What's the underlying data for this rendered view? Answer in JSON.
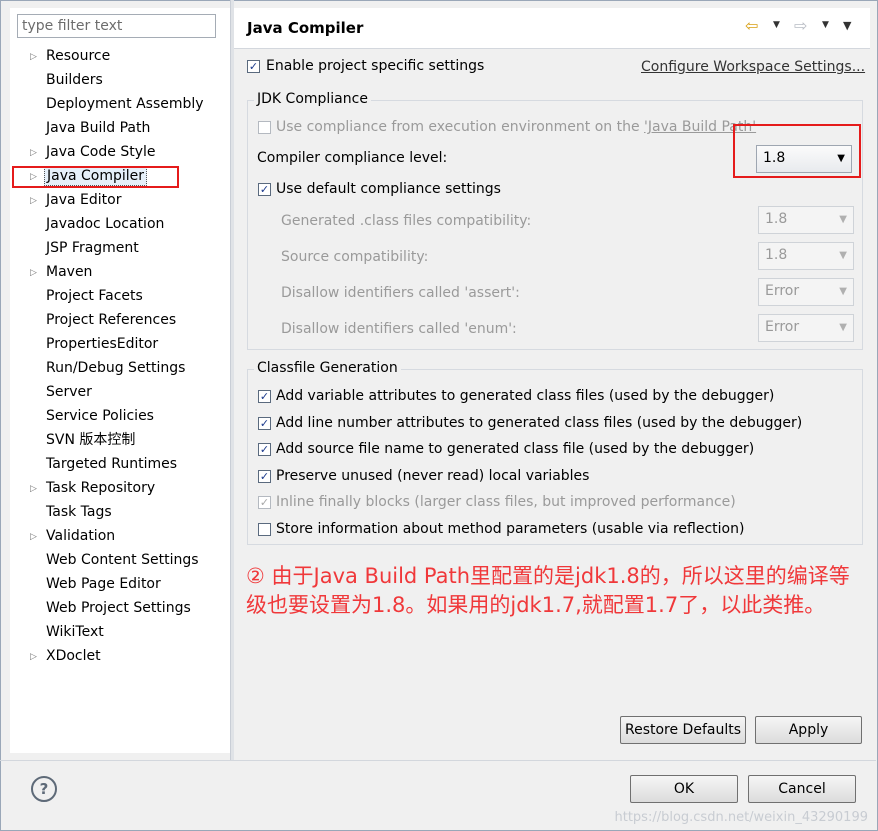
{
  "filter": {
    "placeholder": "type filter text"
  },
  "tree": [
    {
      "label": "Resource",
      "arrow": "▷"
    },
    {
      "label": "Builders",
      "arrow": ""
    },
    {
      "label": "Deployment Assembly",
      "arrow": ""
    },
    {
      "label": "Java Build Path",
      "arrow": ""
    },
    {
      "label": "Java Code Style",
      "arrow": "▷"
    },
    {
      "label": "Java Compiler",
      "arrow": "▷"
    },
    {
      "label": "Java Editor",
      "arrow": "▷"
    },
    {
      "label": "Javadoc Location",
      "arrow": ""
    },
    {
      "label": "JSP Fragment",
      "arrow": ""
    },
    {
      "label": "Maven",
      "arrow": "▷"
    },
    {
      "label": "Project Facets",
      "arrow": ""
    },
    {
      "label": "Project References",
      "arrow": ""
    },
    {
      "label": "PropertiesEditor",
      "arrow": ""
    },
    {
      "label": "Run/Debug Settings",
      "arrow": ""
    },
    {
      "label": "Server",
      "arrow": ""
    },
    {
      "label": "Service Policies",
      "arrow": ""
    },
    {
      "label": "SVN 版本控制",
      "arrow": ""
    },
    {
      "label": "Targeted Runtimes",
      "arrow": ""
    },
    {
      "label": "Task Repository",
      "arrow": "▷"
    },
    {
      "label": "Task Tags",
      "arrow": ""
    },
    {
      "label": "Validation",
      "arrow": "▷"
    },
    {
      "label": "Web Content Settings",
      "arrow": ""
    },
    {
      "label": "Web Page Editor",
      "arrow": ""
    },
    {
      "label": "Web Project Settings",
      "arrow": ""
    },
    {
      "label": "WikiText",
      "arrow": ""
    },
    {
      "label": "XDoclet",
      "arrow": "▷"
    }
  ],
  "selected_tree_index": 5,
  "header": {
    "title": "Java Compiler",
    "back": "⇦",
    "forward": "⇨",
    "caret": "▼",
    "menu": "▼"
  },
  "enable_specific": {
    "label": "Enable project specific settings",
    "checked": "✓"
  },
  "configure_link": "Configure Workspace Settings...",
  "jdk": {
    "title": "JDK Compliance",
    "use_env_prefix": "Use compliance from execution environment on the ",
    "use_env_link": "'Java Build Path'",
    "level_label": "Compiler compliance level:",
    "level_value": "1.8",
    "default_label": "Use default compliance settings",
    "default_checked": "✓",
    "generated_label": "Generated .class files compatibility:",
    "generated_value": "1.8",
    "source_label": "Source compatibility:",
    "source_value": "1.8",
    "assert_label": "Disallow identifiers called 'assert':",
    "assert_value": "Error",
    "enum_label": "Disallow identifiers called 'enum':",
    "enum_value": "Error"
  },
  "classfile": {
    "title": "Classfile Generation",
    "items": [
      {
        "label": "Add variable attributes to generated class files (used by the debugger)",
        "check": "✓"
      },
      {
        "label": "Add line number attributes to generated class files (used by the debugger)",
        "check": "✓"
      },
      {
        "label": "Add source file name to generated class file (used by the debugger)",
        "check": "✓"
      },
      {
        "label": "Preserve unused (never read) local variables",
        "check": "✓"
      },
      {
        "label": "Inline finally blocks (larger class files, but improved performance)",
        "check": "✓"
      },
      {
        "label": "Store information about method parameters (usable via reflection)",
        "check": ""
      }
    ]
  },
  "annotation": "② 由于Java Build Path里配置的是jdk1.8的，所以这里的编译等级也要设置为1.8。如果用的jdk1.7,就配置1.7了，以此类推。",
  "buttons": {
    "restore": "Restore Defaults",
    "apply": "Apply",
    "ok": "OK",
    "cancel": "Cancel"
  },
  "help": "?",
  "combo_arrow": "▼",
  "watermark": "https://blog.csdn.net/weixin_43290199"
}
